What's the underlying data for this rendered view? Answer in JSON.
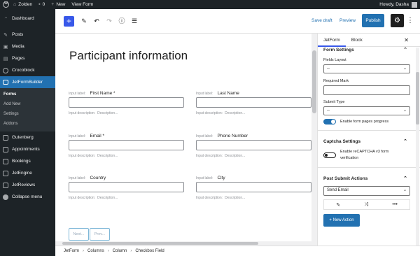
{
  "admin_bar": {
    "site_name": "Zolden",
    "comments_count": "0",
    "new_label": "New",
    "view_label": "View Form",
    "greeting": "Howdy, Dasha"
  },
  "sidebar": {
    "items": [
      {
        "label": "Dashboard",
        "icon": "dashboard-icon"
      },
      {
        "label": "Posts",
        "icon": "pin-icon"
      },
      {
        "label": "Media",
        "icon": "media-icon"
      },
      {
        "label": "Pages",
        "icon": "pages-icon"
      },
      {
        "label": "Crocoblock",
        "icon": "crocoblock-icon"
      },
      {
        "label": "JetFormBuilder",
        "icon": "jetformbuilder-icon"
      },
      {
        "label": "Gutenberg",
        "icon": "gutenberg-icon"
      },
      {
        "label": "Appointments",
        "icon": "appointments-icon"
      },
      {
        "label": "Bookings",
        "icon": "bookings-icon"
      },
      {
        "label": "JetEngine",
        "icon": "jetengine-icon"
      },
      {
        "label": "JetReviews",
        "icon": "jetreviews-icon"
      },
      {
        "label": "Collapse menu",
        "icon": "collapse-icon"
      }
    ],
    "submenu": [
      "Forms",
      "Add New",
      "Settings",
      "Addons"
    ],
    "accent": "#2271b1"
  },
  "toolbar": {
    "save_draft": "Save draft",
    "preview": "Preview",
    "publish": "Publish"
  },
  "canvas": {
    "title": "Participant information",
    "label_prefix": "Input label:",
    "desc_prefix": "Input description:",
    "desc_value": "Description...",
    "fields": [
      {
        "label": "First Name *"
      },
      {
        "label": "Last Name"
      },
      {
        "label": "Email *"
      },
      {
        "label": "Phone Number"
      },
      {
        "label": "Country"
      },
      {
        "label": "City"
      }
    ],
    "next_btn": "Next...",
    "prev_btn": "Prev..."
  },
  "breadcrumbs": [
    "JetForm",
    "Columns",
    "Column",
    "Checkbox Field"
  ],
  "panel": {
    "tabs": [
      "JetForm",
      "Block"
    ],
    "form_settings": {
      "title": "Form Settings",
      "fields_layout_label": "Fields Layout",
      "fields_layout_value": "--",
      "required_mark_label": "Required Mark",
      "submit_type_label": "Submit Type",
      "submit_type_value": "--",
      "pages_progress_label": "Enable form pages progress"
    },
    "captcha": {
      "title": "Captcha Settings",
      "recaptcha_label": "Enable reCAPTCHA v3 form verification"
    },
    "post_submit": {
      "title": "Post Submit Actions",
      "action_value": "Send Email",
      "new_action": "+ New Action"
    }
  }
}
